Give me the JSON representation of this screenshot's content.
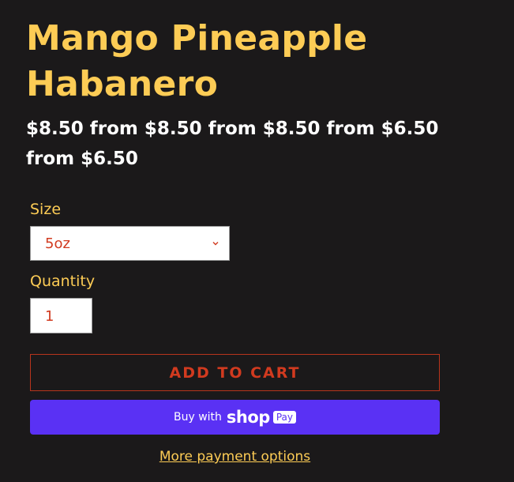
{
  "product": {
    "title": "Mango Pineapple Habanero",
    "price_text": "$8.50 from $8.50 from $8.50 from $6.50 from $6.50"
  },
  "size": {
    "label": "Size",
    "selected": "5oz"
  },
  "quantity": {
    "label": "Quantity",
    "value": "1"
  },
  "buttons": {
    "add_to_cart": "ADD TO CART",
    "buy_with": "Buy with",
    "shop": "shop",
    "pay": "Pay",
    "more_options": "More payment options"
  },
  "colors": {
    "background": "#1b191a",
    "accent": "#fdcc55",
    "price": "#ffffff",
    "cart": "#d13a1f",
    "shop_pay": "#5a31f4"
  },
  "icons": {
    "select_arrow": "chevron-down-icon"
  }
}
